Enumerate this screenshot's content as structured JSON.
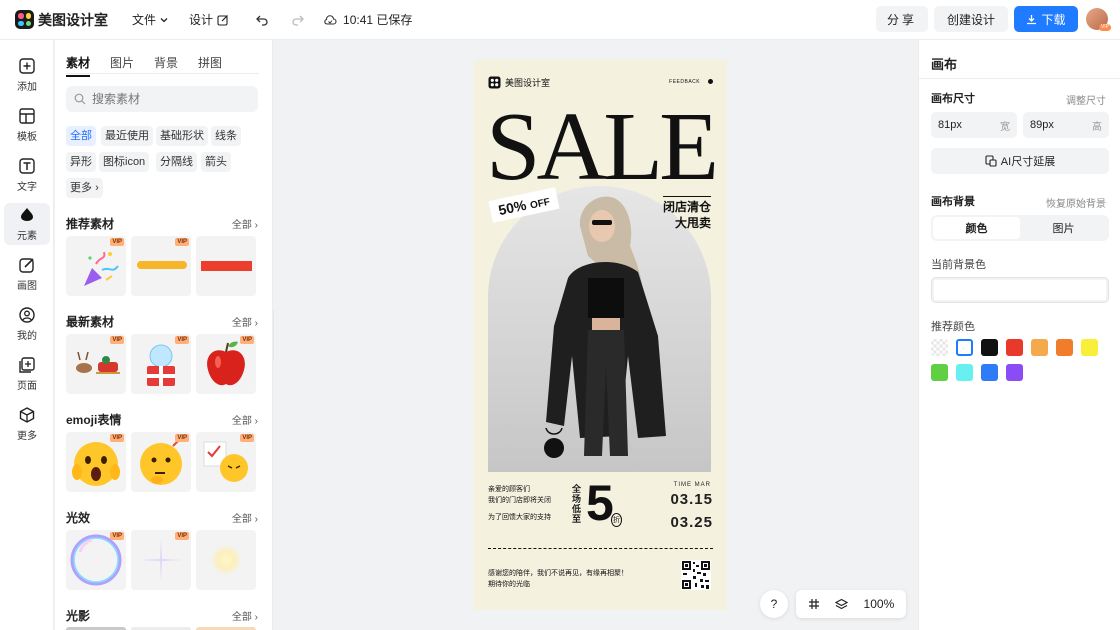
{
  "header": {
    "app_name": "美图设计室",
    "menu_file": "文件",
    "menu_design": "设计",
    "save_status": "10:41 已保存",
    "share": "分享",
    "create": "创建设计",
    "download": "下载",
    "avatar_badge": "VIP"
  },
  "nav": [
    {
      "label": "添加",
      "icon": "plus-square-icon"
    },
    {
      "label": "模板",
      "icon": "template-icon"
    },
    {
      "label": "文字",
      "icon": "text-icon"
    },
    {
      "label": "元素",
      "icon": "element-icon"
    },
    {
      "label": "画图",
      "icon": "draw-icon"
    },
    {
      "label": "我的",
      "icon": "user-icon"
    },
    {
      "label": "页面",
      "icon": "page-add-icon"
    },
    {
      "label": "更多",
      "icon": "cube-icon"
    }
  ],
  "panel": {
    "tabs": [
      "素材",
      "图片",
      "背景",
      "拼图"
    ],
    "search_placeholder": "搜索素材",
    "chips": [
      "全部",
      "最近使用",
      "基础形状",
      "线条",
      "异形",
      "图标icon",
      "分隔线",
      "箭头",
      "更多"
    ],
    "sections": [
      {
        "title": "推荐素材",
        "all": "全部"
      },
      {
        "title": "最新素材",
        "all": "全部"
      },
      {
        "title": "emoji表情",
        "all": "全部"
      },
      {
        "title": "光效",
        "all": "全部"
      },
      {
        "title": "光影",
        "all": "全部"
      }
    ],
    "vip": "VIP"
  },
  "poster": {
    "brand": "美图设计室",
    "feedback": "FEEDBACK",
    "sale": "SALE",
    "off_num": "50%",
    "off_text": "OFF",
    "closing_1": "闭店清仓",
    "closing_2": "大甩卖",
    "info_1": "亲爱的顾客们",
    "info_2": "我们的门店即将关闭",
    "info_3": "为了回馈大家的支持",
    "whole": "全场低至",
    "five": "5",
    "zhe": "折",
    "time": "TIME  MAR",
    "date_1": "03.15",
    "date_2": "03.25",
    "foot_1": "感谢您的陪伴，我们不说再见，有缘再相聚！",
    "foot_2": "期待你的光临"
  },
  "bottom": {
    "help": "?",
    "zoom": "100%"
  },
  "right": {
    "title": "画布",
    "size_label": "画布尺寸",
    "size_link": "调整尺寸",
    "width_value": "81px",
    "width_unit": "宽",
    "height_value": "89px",
    "height_unit": "高",
    "ai_extend": "AI尺寸延展",
    "bg_label": "画布背景",
    "bg_reset": "恢复原始背景",
    "seg_color": "颜色",
    "seg_image": "图片",
    "current_bg": "当前背景色",
    "recommend": "推荐颜色",
    "swatches": [
      "transparent",
      "#ffffff",
      "#111111",
      "#e8392a",
      "#f4a94c",
      "#ef7d2c",
      "#f8ef3b",
      "#5fcf44",
      "#66f0f0",
      "#2f7cf6",
      "#8a4cf5"
    ]
  }
}
